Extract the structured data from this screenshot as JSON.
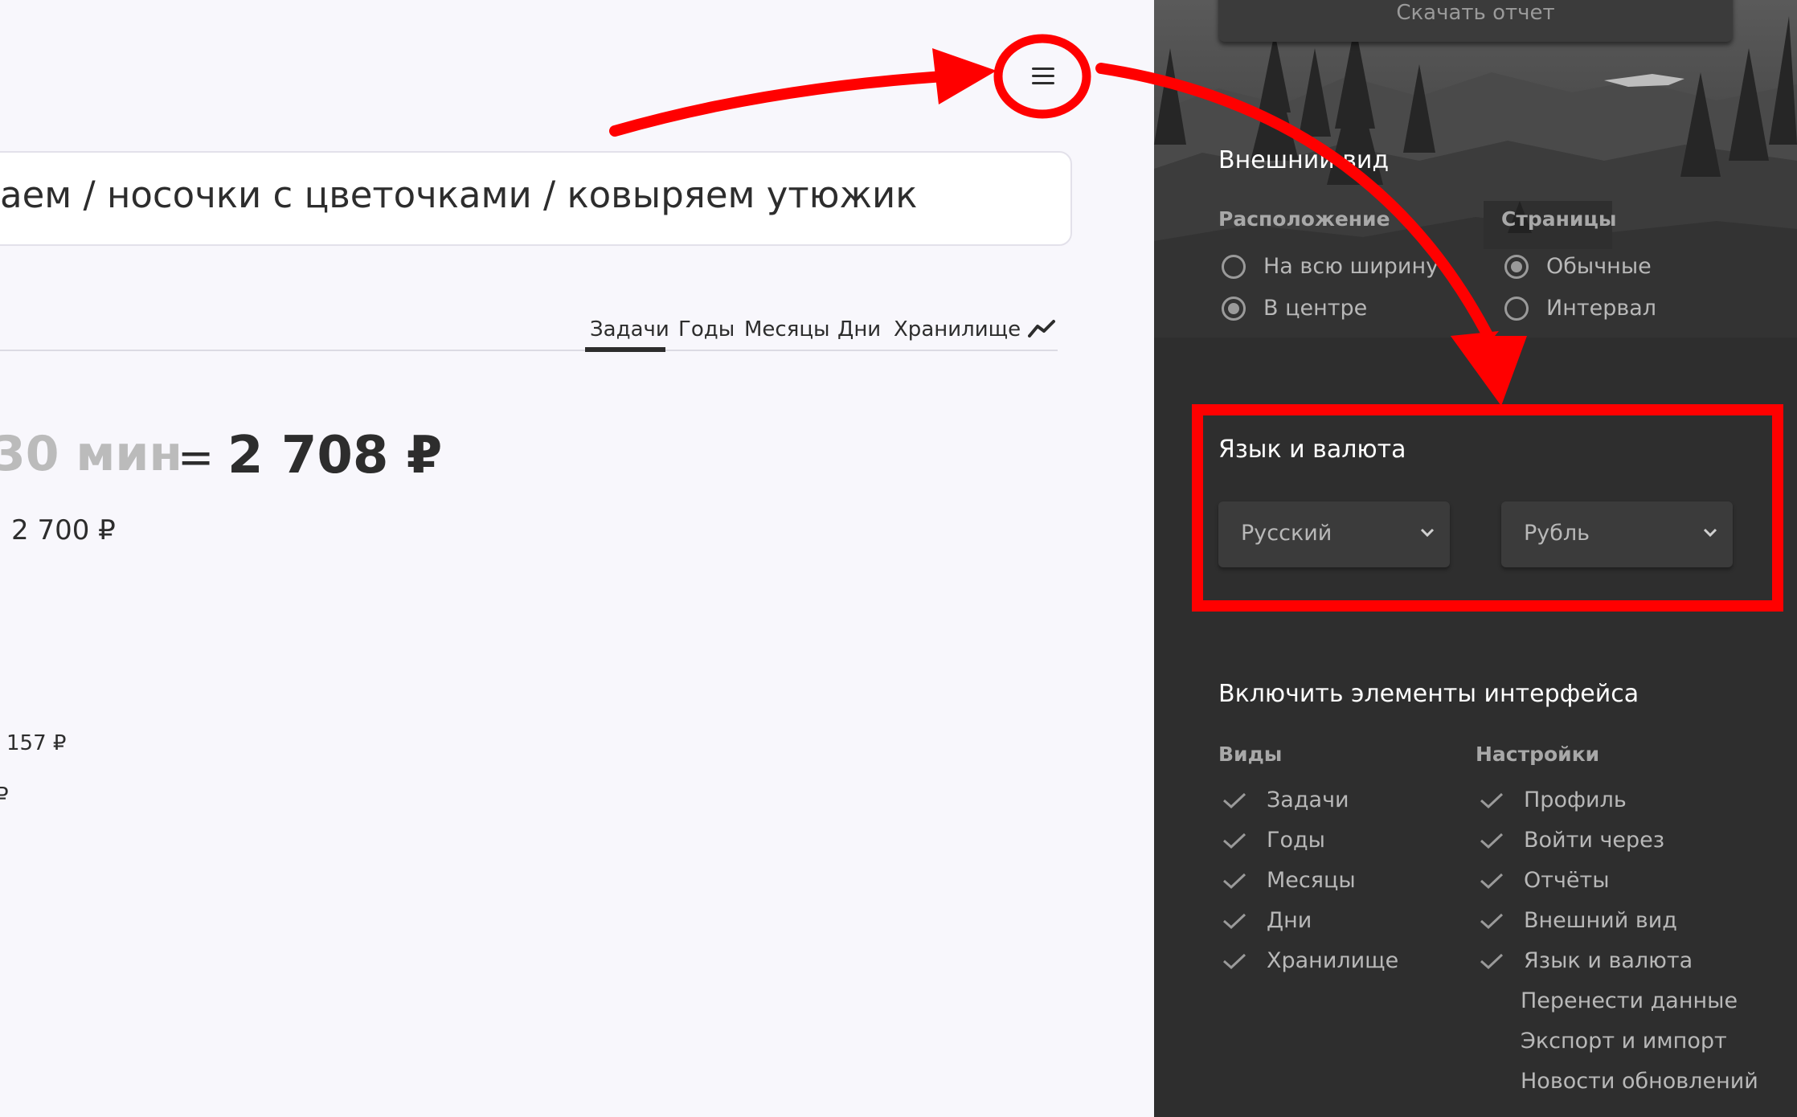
{
  "main": {
    "task_path": "аем / носочки с цветочками / ковыряем утюжик",
    "tabs": [
      {
        "label": "Задачи",
        "active": true
      },
      {
        "label": "Годы",
        "active": false
      },
      {
        "label": "Месяцы",
        "active": false
      },
      {
        "label": "Дни",
        "active": false
      },
      {
        "label": "Хранилище",
        "active": false
      }
    ],
    "chart_icon": "trend-line-icon",
    "time_value": "30 мин",
    "equals": "=",
    "total": "2 708 ₽",
    "sub_amount": "2 700 ₽",
    "amount_small_1": "157 ₽",
    "amount_small_2": "₽",
    "menu_icon": "hamburger-menu-icon"
  },
  "panel": {
    "download_button": "Скачать отчет",
    "appearance": {
      "title": "Внешний вид",
      "layout_label": "Расположение",
      "layout_options": [
        {
          "label": "На всю ширину",
          "selected": false
        },
        {
          "label": "В центре",
          "selected": true
        }
      ],
      "pages_label": "Страницы",
      "pages_options": [
        {
          "label": "Обычные",
          "selected": true
        },
        {
          "label": "Интервал",
          "selected": false
        }
      ]
    },
    "language_currency": {
      "title": "Язык и валюта",
      "language": "Русский",
      "currency": "Рубль"
    },
    "interface": {
      "title": "Включить элементы интерфейса",
      "views_label": "Виды",
      "views": [
        "Задачи",
        "Годы",
        "Месяцы",
        "Дни",
        "Хранилище"
      ],
      "settings_label": "Настройки",
      "settings_checked": [
        "Профиль",
        "Войти через",
        "Отчёты",
        "Внешний вид",
        "Язык и валюта"
      ],
      "settings_unchecked": [
        "Перенести данные",
        "Экспорт и импорт",
        "Новости обновлений"
      ]
    }
  },
  "colors": {
    "annotation": "#ff0000",
    "panel_bg": "#2e2e2e",
    "main_bg": "#f8f7fc"
  }
}
